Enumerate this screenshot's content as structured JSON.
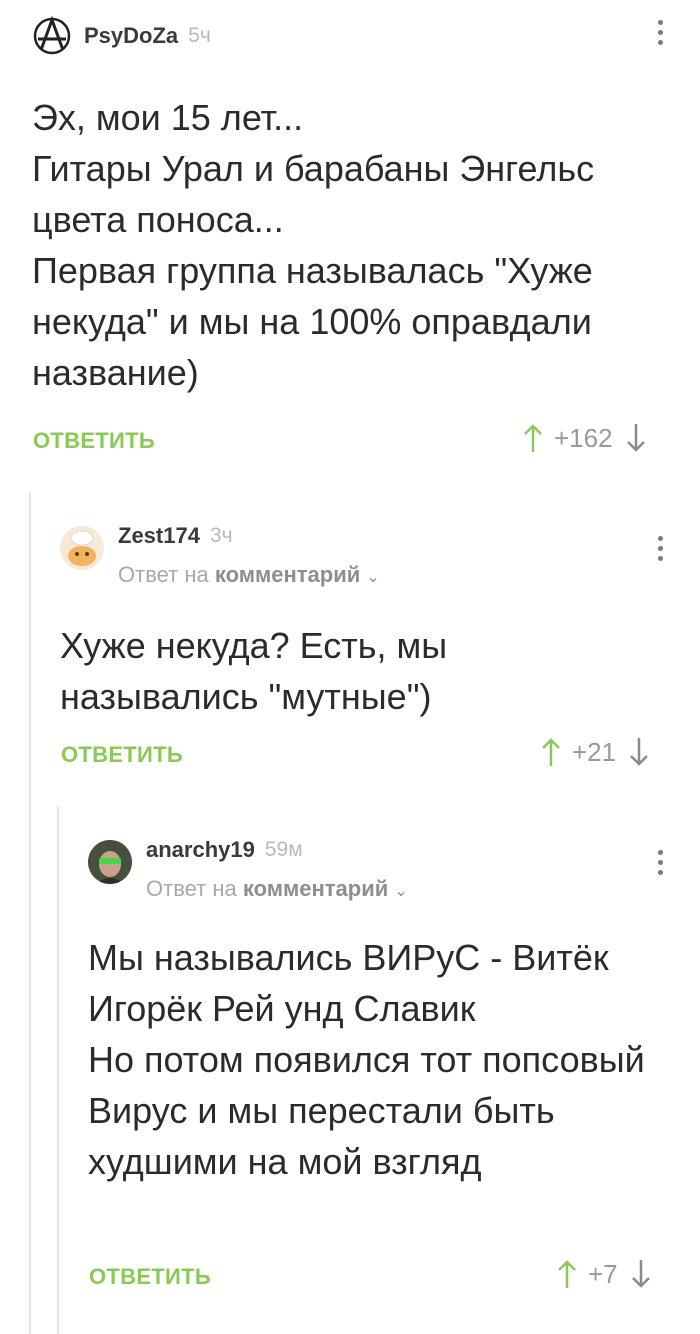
{
  "colors": {
    "accent_green": "#8ac858",
    "text": "#2b2b2b",
    "muted": "#a8a8a8"
  },
  "comments": [
    {
      "author": "PsyDoZa",
      "time": "5ч",
      "avatar_icon": "anarchy-symbol-icon",
      "text": "Эх, мои 15 лет...\nГитары Урал и барабаны Энгельс цвета поноса...\nПервая группа называлась \"Хуже некуда\" и мы на 100% оправдали название)",
      "reply_label": "ОТВЕТИТЬ",
      "score": "+162"
    },
    {
      "author": "Zest174",
      "time": "3ч",
      "avatar_icon": "chef-avatar-icon",
      "reply_to_prefix": "Ответ на",
      "reply_to_target": "комментарий",
      "text": "Хуже некуда? Есть, мы назывались \"мутные\")",
      "reply_label": "ОТВЕТИТЬ",
      "score": "+21"
    },
    {
      "author": "anarchy19",
      "time": "59м",
      "avatar_icon": "person-sunglasses-avatar-icon",
      "reply_to_prefix": "Ответ на",
      "reply_to_target": "комментарий",
      "text": "Мы назывались ВИРуС - Витёк Игорёк Рей унд Славик\nНо потом появился тот попсовый Вирус и мы перестали быть худшими на мой взгляд",
      "reply_label": "ОТВЕТИТЬ",
      "score": "+7"
    }
  ]
}
